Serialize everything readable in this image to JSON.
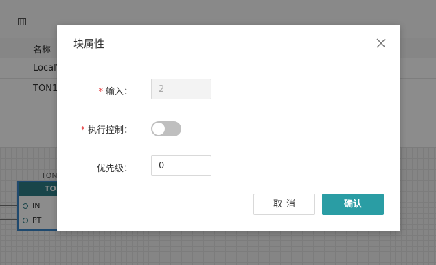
{
  "background": {
    "table": {
      "header": "名称",
      "rows": [
        "Local\\",
        "TON1"
      ]
    },
    "canvas": {
      "block_name": "TON",
      "block_title": "TON",
      "pins": [
        "IN",
        "PT"
      ]
    }
  },
  "dialog": {
    "title": "块属性",
    "fields": {
      "input": {
        "label": "输入：",
        "value": "2",
        "required": true
      },
      "exec_control": {
        "label": "执行控制：",
        "enabled": false,
        "required": true
      },
      "priority": {
        "label": "优先级：",
        "value": "0"
      }
    },
    "buttons": {
      "cancel": "取消",
      "ok": "确认"
    }
  },
  "colors": {
    "accent": "#2a9da4",
    "required": "#e4393c",
    "block_header": "#2f7f88",
    "selection": "#3a86c9"
  },
  "icons": [
    "table-icon",
    "close-icon"
  ]
}
